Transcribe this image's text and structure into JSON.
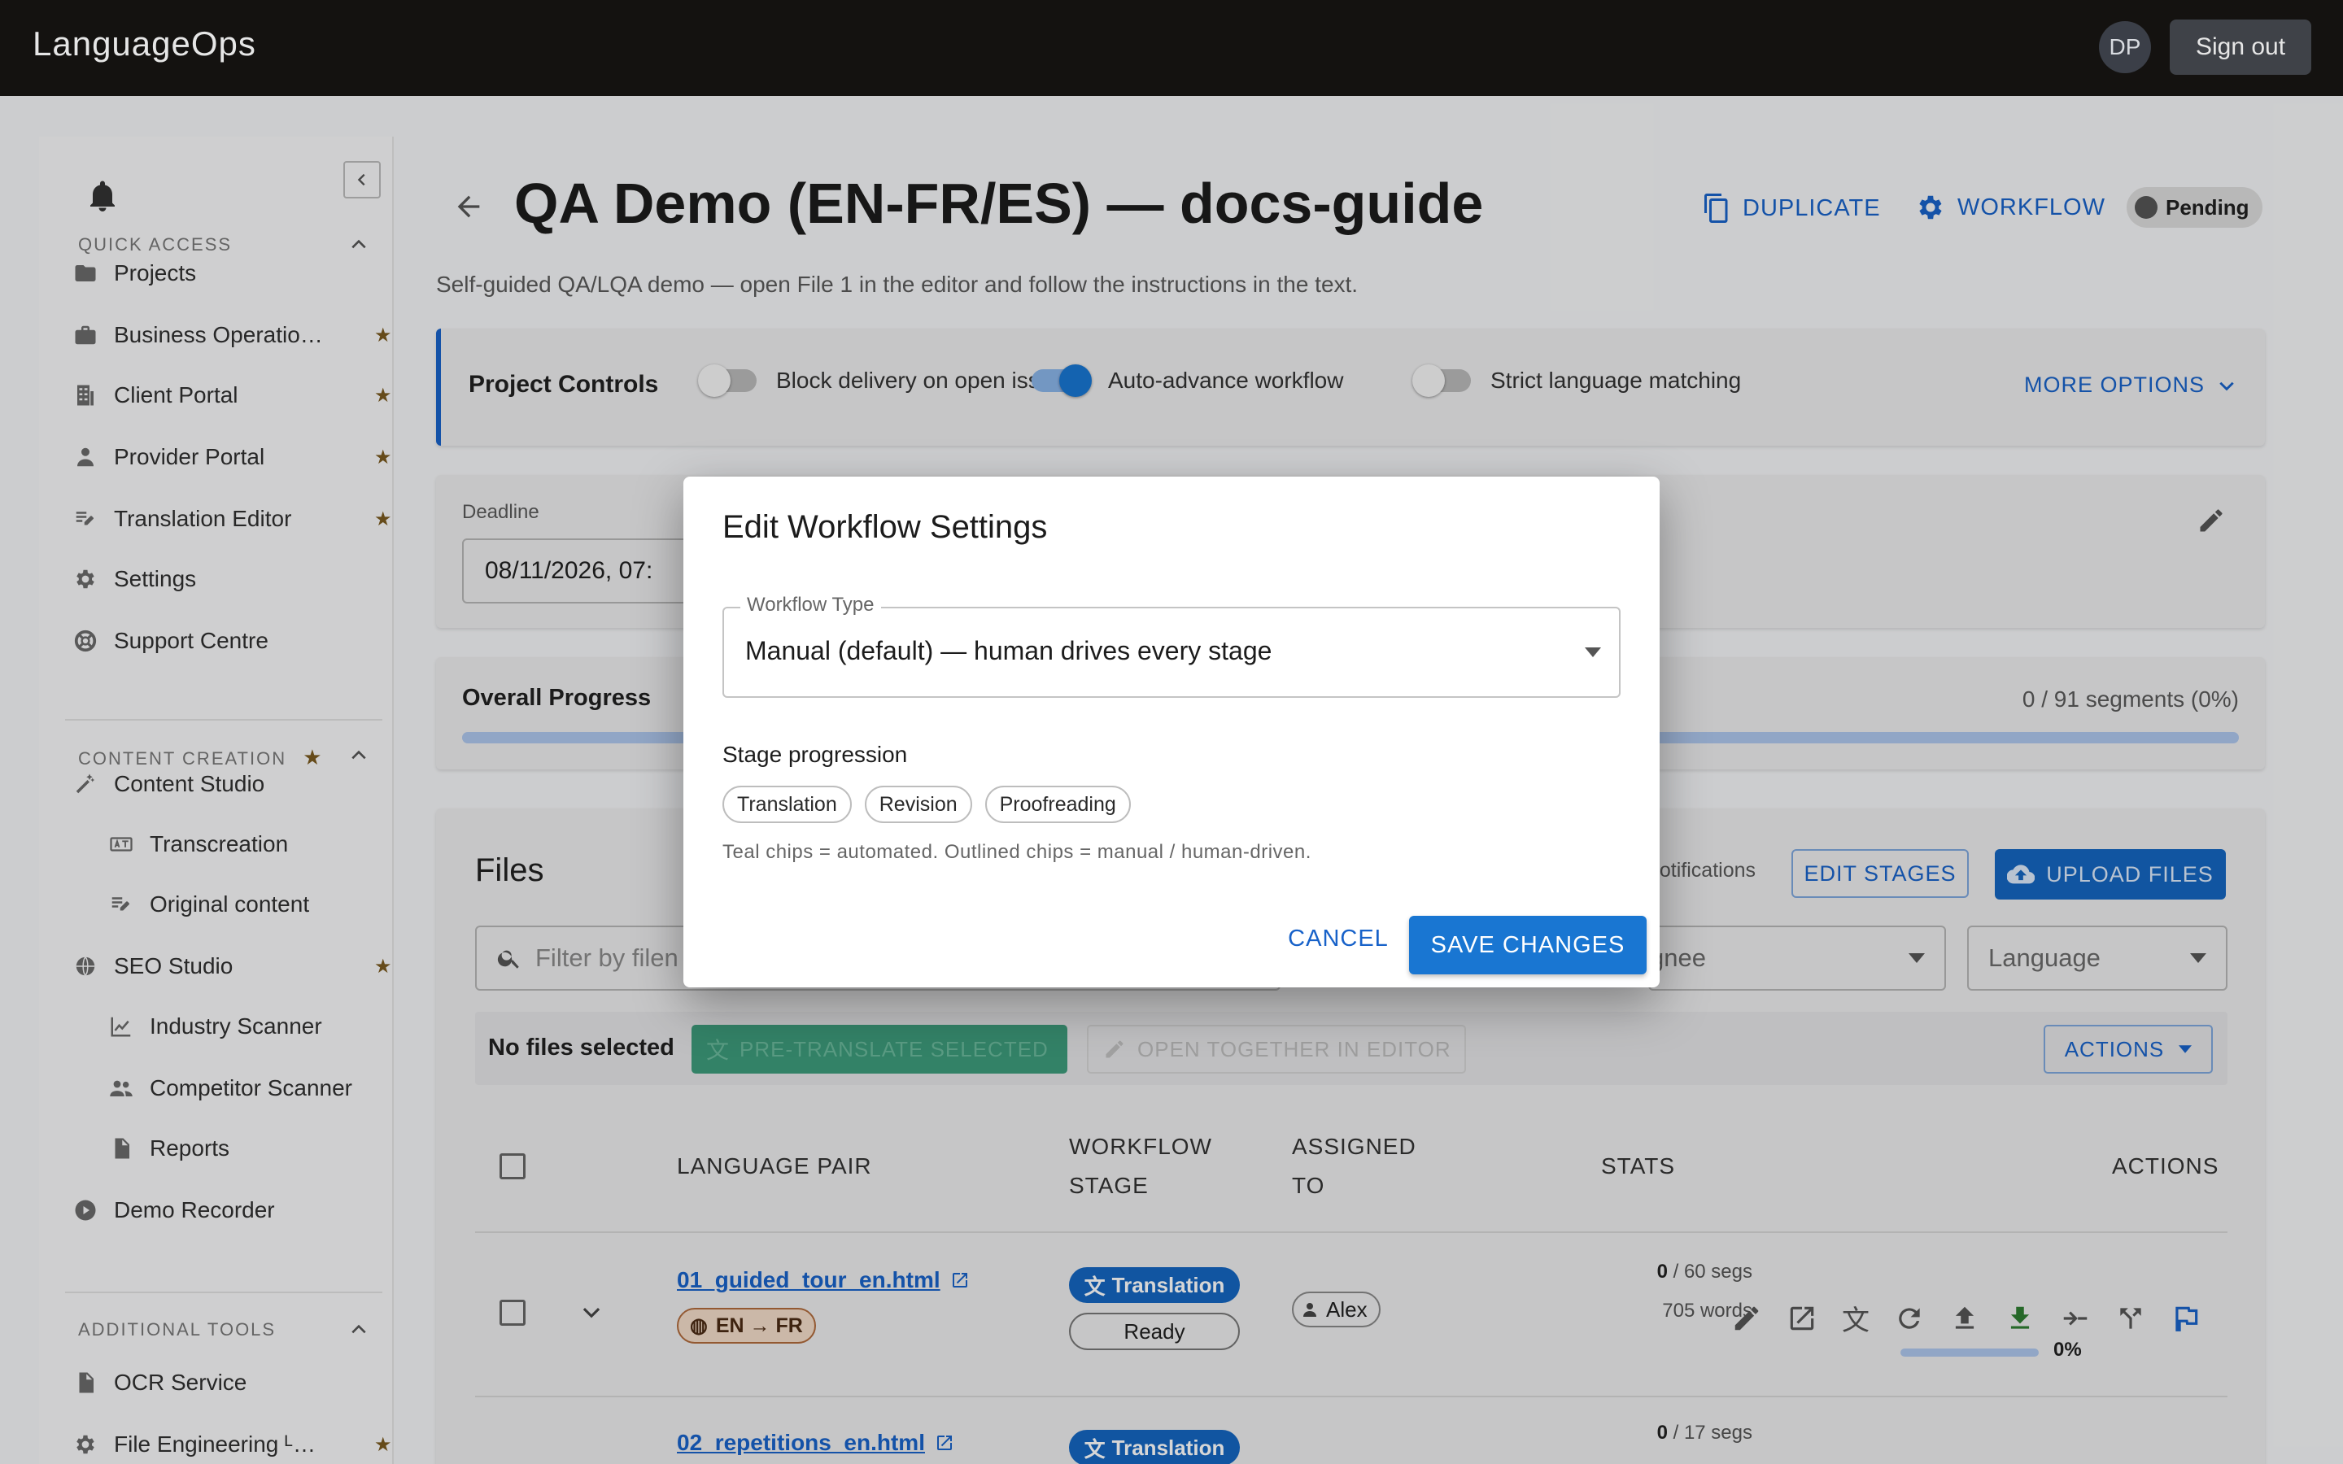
{
  "app": {
    "brand": "LanguageOps",
    "avatar_initials": "DP",
    "signout": "Sign out"
  },
  "sidebar": {
    "quick_access": "QUICK ACCESS",
    "quick_items": [
      {
        "label": "Projects",
        "icon": "folder-icon",
        "starred": false
      },
      {
        "label": "Business Operatio…",
        "icon": "briefcase-icon",
        "starred": true
      },
      {
        "label": "Client Portal",
        "icon": "building-icon",
        "starred": true
      },
      {
        "label": "Provider Portal",
        "icon": "person-badge-icon",
        "starred": true
      },
      {
        "label": "Translation Editor",
        "icon": "edit-note-icon",
        "starred": true
      },
      {
        "label": "Settings",
        "icon": "gear-icon",
        "starred": false
      },
      {
        "label": "Support Centre",
        "icon": "lifebuoy-icon",
        "starred": false
      }
    ],
    "content_creation": "CONTENT CREATION",
    "content_items": [
      {
        "label": "Content Studio",
        "icon": "magic-wand-icon",
        "sub": false,
        "starred": false
      },
      {
        "label": "Transcreation",
        "icon": "translate-box-icon",
        "sub": true,
        "starred": false
      },
      {
        "label": "Original content",
        "icon": "edit-note-icon",
        "sub": true,
        "starred": false
      },
      {
        "label": "SEO Studio",
        "icon": "globe-icon",
        "sub": false,
        "starred": true
      },
      {
        "label": "Industry Scanner",
        "icon": "chart-line-icon",
        "sub": true,
        "starred": false
      },
      {
        "label": "Competitor Scanner",
        "icon": "people-icon",
        "sub": true,
        "starred": false
      },
      {
        "label": "Reports",
        "icon": "document-icon",
        "sub": true,
        "starred": false
      },
      {
        "label": "Demo Recorder",
        "icon": "play-circle-icon",
        "sub": false,
        "starred": false
      }
    ],
    "additional_tools": "ADDITIONAL TOOLS",
    "tool_items": [
      {
        "label": "OCR Service",
        "icon": "document-scan-icon",
        "starred": false
      },
      {
        "label": "File Engineering ᴸ…",
        "icon": "gear-icon",
        "starred": true
      }
    ]
  },
  "project": {
    "title": "QA Demo (EN-FR/ES) — docs-guide",
    "subtitle": "Self-guided QA/LQA demo — open File 1 in the editor and follow the instructions in the text.",
    "duplicate": "DUPLICATE",
    "workflow": "WORKFLOW",
    "status": "Pending"
  },
  "controls": {
    "title": "Project Controls",
    "toggles": [
      {
        "label": "Block delivery on open issues",
        "on": false
      },
      {
        "label": "Auto-advance workflow",
        "on": true
      },
      {
        "label": "Strict language matching",
        "on": false
      }
    ],
    "more": "MORE OPTIONS"
  },
  "deadline": {
    "label": "Deadline",
    "value": "08/11/2026, 07:"
  },
  "progress": {
    "label": "Overall Progress",
    "summary": "0 / 91 segments (0%)",
    "fraction": 0
  },
  "files": {
    "title": "Files",
    "notifications": "notifications",
    "edit_stages": "EDIT STAGES",
    "upload": "UPLOAD FILES",
    "filter_placeholder": "Filter by filen",
    "assignee_placeholder": "gnee",
    "language_placeholder": "Language",
    "none_selected": "No files selected",
    "pretranslate": "PRE-TRANSLATE SELECTED",
    "open_together": "OPEN TOGETHER IN EDITOR",
    "actions": "ACTIONS",
    "headers": {
      "lang": "LANGUAGE PAIR",
      "stage1": "WORKFLOW",
      "stage2": "STAGE",
      "assigned1": "ASSIGNED",
      "assigned2": "TO",
      "stats": "STATS",
      "actions": "ACTIONS"
    },
    "rows": [
      {
        "name": "01_guided_tour_en.html",
        "pair": "EN → FR",
        "stage": "Translation",
        "state": "Ready",
        "assignee": "Alex",
        "segs_done": "0",
        "segs_total": " / 60 segs",
        "words": "705 words",
        "pct": "0%"
      },
      {
        "name": "02_repetitions_en.html",
        "stage": "Translation",
        "segs_done": "0",
        "segs_total": " / 17 segs"
      }
    ]
  },
  "dialog": {
    "title": "Edit Workflow Settings",
    "field_label": "Workflow Type",
    "field_value": "Manual (default) — human drives every stage",
    "stage_label": "Stage progression",
    "chips": [
      "Translation",
      "Revision",
      "Proofreading"
    ],
    "hint": "Teal chips = automated. Outlined chips = manual / human-driven.",
    "cancel": "CANCEL",
    "save": "SAVE CHANGES"
  },
  "colors": {
    "accent": "#1976d2",
    "teal": "#3d9b7b",
    "star": "#7a5a1f",
    "topbar": "#141210"
  }
}
